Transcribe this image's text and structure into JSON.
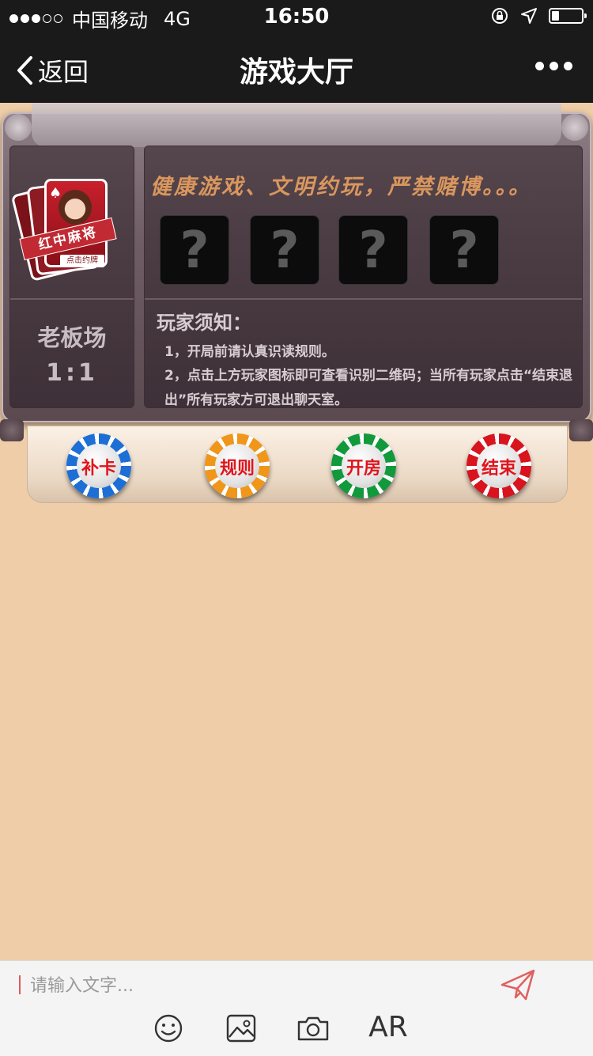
{
  "status_bar": {
    "carrier": "中国移动",
    "network": "4G",
    "time": "16:50",
    "battery_level": 0.25
  },
  "nav": {
    "back_label": "返回",
    "title": "游戏大厅"
  },
  "game": {
    "logo_text": "红中麻将",
    "logo_subtext": "点击约牌",
    "room_name": "老板场",
    "room_ratio": "1:1",
    "slogan": "健康游戏、文明约玩，严禁赌博。。。",
    "seats": [
      "?",
      "?",
      "?",
      "?"
    ],
    "notice_title": "玩家须知：",
    "notice_items": [
      "1，开局前请认真识读规则。",
      "2，点击上方玩家图标即可查看识别二维码；当所有玩家点击“结束退出”所有玩家方可退出聊天室。"
    ]
  },
  "buttons": {
    "supplement": "补卡",
    "rules": "规则",
    "open_room": "开房",
    "end": "结束"
  },
  "input": {
    "placeholder": "请输入文字...",
    "ar_label": "AR"
  },
  "icons": {
    "back": "chevron-left-icon",
    "more": "more-icon",
    "send": "paper-plane-icon",
    "emoji": "smiley-icon",
    "image": "image-icon",
    "camera": "camera-icon"
  },
  "colors": {
    "background": "#efcda8",
    "bar": "#1a1a1a",
    "button_text": "#e1141c",
    "slogan": "#d9975e"
  }
}
